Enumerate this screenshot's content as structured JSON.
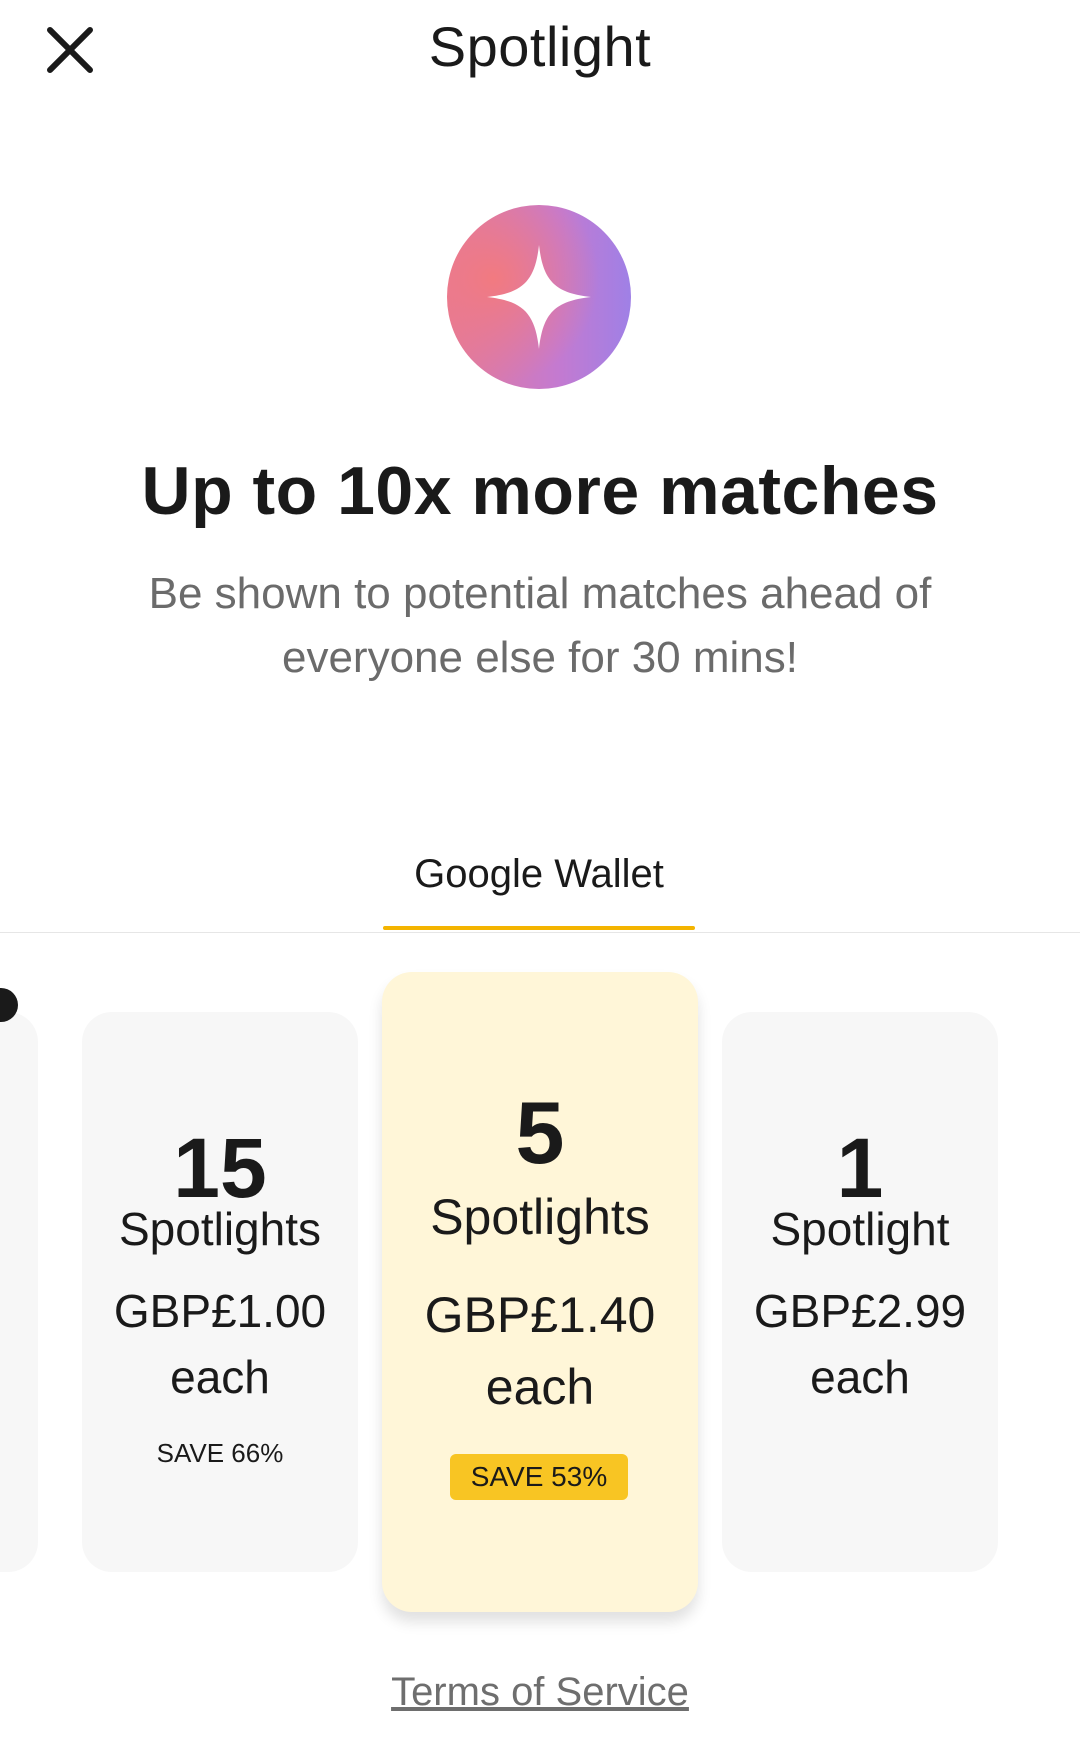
{
  "header": {
    "title": "Spotlight",
    "close_icon": "close-icon"
  },
  "hero": {
    "icon": "sparkle-icon",
    "icon_gradient": [
      "#f07a82",
      "#9a7ee0"
    ],
    "headline": "Up to 10x more matches",
    "subtext": "Be shown to potential matches ahead of everyone else for 30 mins!"
  },
  "payment_tabs": {
    "active": "Google Wallet",
    "underline_color": "#f4b400"
  },
  "packages": [
    {
      "quantity": "15",
      "unit": "Spotlights",
      "price": "GBP£1.00",
      "each": "each",
      "save": "SAVE 66%",
      "selected": false
    },
    {
      "quantity": "5",
      "unit": "Spotlights",
      "price": "GBP£1.40",
      "each": "each",
      "save": "SAVE 53%",
      "selected": true,
      "highlight_color": "#fff6d8",
      "save_pill_color": "#f8c523"
    },
    {
      "quantity": "1",
      "unit": "Spotlight",
      "price": "GBP£2.99",
      "each": "each",
      "save": "",
      "selected": false
    }
  ],
  "footer": {
    "terms_link": "Terms of Service"
  }
}
